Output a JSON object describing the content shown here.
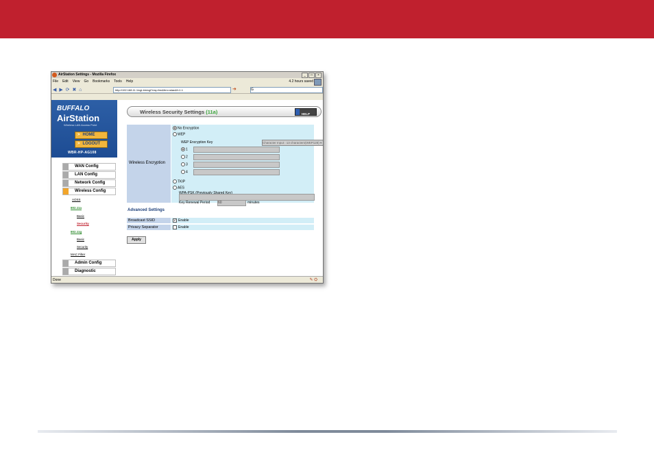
{
  "window": {
    "title": "AirStation Settings - Mozilla Firefox",
    "controls": [
      "_",
      "□",
      "×"
    ]
  },
  "menu": [
    "File",
    "Edit",
    "View",
    "Go",
    "Bookmarks",
    "Tools",
    "Help"
  ],
  "saved_status": "4.2 hours saved",
  "address": "http://192.168.11.1/cgi-bin/cgi?req=frm&frm=wlan&f=1.1",
  "search_value": "G",
  "brand": {
    "logo": "BUFFALO",
    "product": "AirStation",
    "tagline": "Wireless LAN Access Point",
    "home": "HOME",
    "logout": "LOGOUT",
    "model": "WBR-HP-AG108"
  },
  "nav": {
    "wan": "WAN Config",
    "lan": "LAN Config",
    "network": "Network Config",
    "wireless": "Wireless Config",
    "aoss": "AOSS",
    "a_band": "802.11a",
    "a_basic": "Basic",
    "a_security": "Security",
    "g_band": "802.11g",
    "g_basic": "Basic",
    "g_security": "Security",
    "mac_filter": "MAC Filter",
    "admin": "Admin Config",
    "diagnostic": "Diagnostic"
  },
  "page": {
    "title": "Wireless Security Settings",
    "band": "(11a)",
    "help": "HELP"
  },
  "encryption": {
    "label": "Wireless Encryption",
    "no_encryption": "No Encryption",
    "wep": "WEP",
    "wep_key_label": "WEP Encryption Key",
    "wep_key_select": "Character Input : 13 characters(WEP128)",
    "key1": "1",
    "key2": "2",
    "key3": "3",
    "key4": "4",
    "tkip": "TKIP",
    "aes": "AES",
    "psk_label": "WPA-PSK (Previously Shared Key)",
    "renewal_label": "Key Renewal Period",
    "renewal_value": "60",
    "renewal_unit": "minutes"
  },
  "advanced": {
    "heading": "Advanced Settings",
    "broadcast_label": "Broadcast SSID",
    "broadcast_value": "Enable",
    "privacy_label": "Privacy Separator",
    "privacy_value": "Enable",
    "apply": "Apply"
  },
  "status": "Done"
}
